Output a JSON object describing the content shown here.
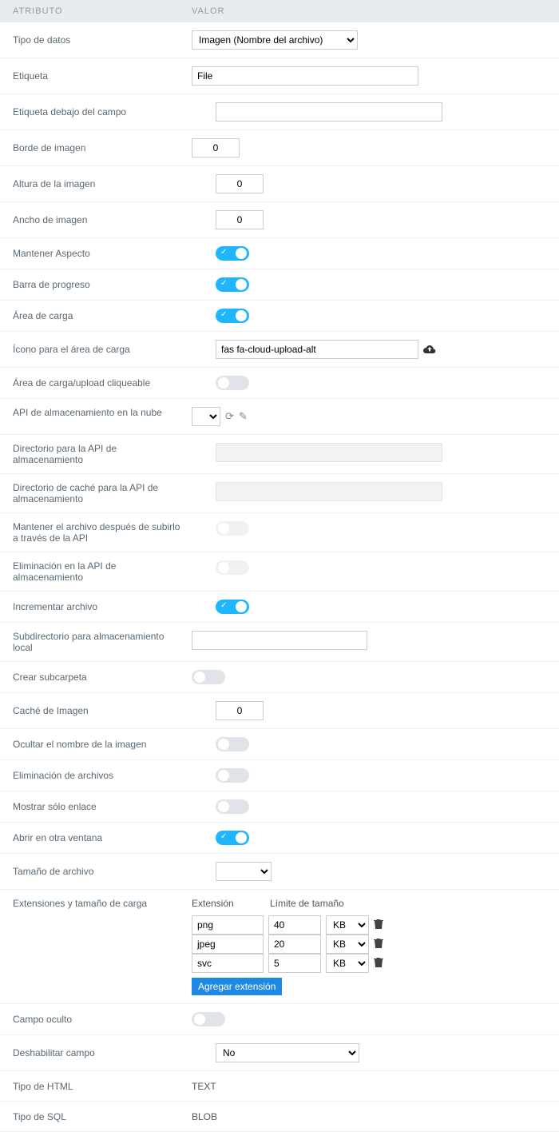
{
  "header": {
    "attr": "ATRIBUTO",
    "val": "VALOR"
  },
  "rows": {
    "datatype": {
      "label": "Tipo de datos",
      "value": "Imagen (Nombre del archivo)"
    },
    "etiqueta": {
      "label": "Etiqueta",
      "value": "File"
    },
    "etiqueta_debajo": {
      "label": "Etiqueta debajo del campo",
      "value": ""
    },
    "borde": {
      "label": "Borde de imagen",
      "value": "0"
    },
    "altura": {
      "label": "Altura de la imagen",
      "value": "0"
    },
    "ancho": {
      "label": "Ancho de imagen",
      "value": "0"
    },
    "aspecto": {
      "label": "Mantener Aspecto",
      "on": true
    },
    "progreso": {
      "label": "Barra de progreso",
      "on": true
    },
    "area_carga": {
      "label": "Área de carga",
      "on": true
    },
    "icono_area": {
      "label": "Ícono para el área de carga",
      "value": "fas fa-cloud-upload-alt"
    },
    "area_click": {
      "label": "Área de carga/upload cliqueable",
      "on": false
    },
    "api_nube": {
      "label": "API de almacenamiento en la nube",
      "value": ""
    },
    "dir_api": {
      "label": "Directorio para la API de almacenamiento"
    },
    "dir_cache_api": {
      "label": "Directorio de caché para la API de almacenamiento"
    },
    "mantener_api": {
      "label": "Mantener el archivo después de subirlo a través de la API",
      "on": false
    },
    "elim_api": {
      "label": "Eliminación en la API de almacenamiento",
      "on": false
    },
    "incrementar": {
      "label": "Incrementar archivo",
      "on": true
    },
    "subdir_local": {
      "label": "Subdirectorio para almacenamiento local",
      "value": ""
    },
    "crear_sub": {
      "label": "Crear subcarpeta",
      "on": false
    },
    "cache_img": {
      "label": "Caché de Imagen",
      "value": "0"
    },
    "ocultar_nombre": {
      "label": "Ocultar el nombre de la imagen",
      "on": false
    },
    "elim_arch": {
      "label": "Eliminación de archivos",
      "on": false
    },
    "solo_enlace": {
      "label": "Mostrar sólo enlace",
      "on": false
    },
    "abrir_ventana": {
      "label": "Abrir en otra ventana",
      "on": true
    },
    "tam_archivo": {
      "label": "Tamaño de archivo",
      "value": ""
    },
    "extensiones": {
      "label": "Extensiones y tamaño de carga"
    },
    "campo_oculto": {
      "label": "Campo oculto",
      "on": false
    },
    "deshabilitar": {
      "label": "Deshabilitar campo",
      "value": "No"
    },
    "tipo_html": {
      "label": "Tipo de HTML",
      "value": "TEXT"
    },
    "tipo_sql": {
      "label": "Tipo de SQL",
      "value": "BLOB"
    }
  },
  "ext_table": {
    "col_ext": "Extensión",
    "col_lim": "Límite de tamaño",
    "add_btn": "Agregar extensión",
    "rows": [
      {
        "ext": "png",
        "size": "40",
        "unit": "KB"
      },
      {
        "ext": "jpeg",
        "size": "20",
        "unit": "KB"
      },
      {
        "ext": "svc",
        "size": "5",
        "unit": "KB"
      }
    ]
  }
}
